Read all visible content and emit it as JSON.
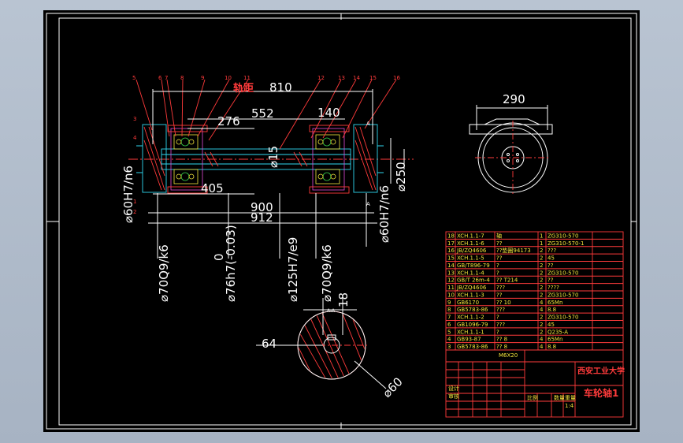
{
  "drawing": {
    "title_cn": "车轮轴1",
    "school": "西安工业大学",
    "dimensions": {
      "track_label": "轨距",
      "overall": "810",
      "d552": "552",
      "d276": "276",
      "d140": "140",
      "d405": "405",
      "d900": "900",
      "d912": "912",
      "d290": "290",
      "d250": "⌀250",
      "d15": "⌀15",
      "d64": "64",
      "d18": "18",
      "d60": "⌀60",
      "fit_left": "⌀60H7/n6",
      "fit_right": "⌀60H7/n6",
      "fit1": "⌀70Q9/k6",
      "fit2": "⌀76h7(-0.03)",
      "fit2_tol": "0",
      "fit3": "⌀125H7/e9",
      "fit4": "⌀70Q9/k6",
      "section_label": "A-A",
      "section_mark": "A"
    },
    "balloons": [
      "5",
      "6",
      "7",
      "8",
      "9",
      "10",
      "11",
      "12",
      "13",
      "14",
      "15",
      "16",
      "3",
      "4",
      "1",
      "2"
    ],
    "bom": [
      [
        "18",
        "XCH.1.1-7",
        "轴",
        "1",
        "ZG310-570",
        ""
      ],
      [
        "17",
        "XCH.1.1-6",
        "??",
        "1",
        "ZG310-570-1",
        ""
      ],
      [
        "16",
        "JB/ZQ4606",
        "??垫圈94173",
        "2",
        "???",
        ""
      ],
      [
        "15",
        "XCH.1.1-5",
        "??",
        "2",
        "45",
        ""
      ],
      [
        "14",
        "GB/T896-79",
        "?",
        "2",
        "??",
        ""
      ],
      [
        "13",
        "XCH.1.1-4",
        "?",
        "2",
        "ZG310-570",
        ""
      ],
      [
        "12",
        "GB/T 26m-4",
        "?? T214",
        "2",
        "??",
        ""
      ],
      [
        "11",
        "JB/ZQ4606",
        "???",
        "2",
        "????",
        ""
      ],
      [
        "10",
        "XCH.1.1-3",
        "??",
        "2",
        "ZG310-570",
        ""
      ],
      [
        "9",
        "GB6170",
        "?? 10",
        "4",
        "65Mn",
        ""
      ],
      [
        "8",
        "GB5783-86",
        "???",
        "4",
        "8.8",
        ""
      ],
      [
        "7",
        "XCH.1.1-2",
        "?",
        "2",
        "ZG310-570",
        ""
      ],
      [
        "6",
        "GB1096-79",
        "???",
        "2",
        "45",
        ""
      ],
      [
        "5",
        "XCH.1.1-1",
        "?",
        "2",
        "Q235-A",
        ""
      ],
      [
        "4",
        "GB93-87",
        "?? 8",
        "4",
        "65Mn",
        ""
      ],
      [
        "3",
        "GB5783-86",
        "?? 8",
        "4",
        "8.8",
        ""
      ]
    ],
    "bom_header_code": "M6X20",
    "title_block": {
      "scale_label": "比例",
      "scale": "1:4",
      "qty_label": "数量",
      "weight_label": "重量",
      "designer": "设计",
      "checker": "审核"
    }
  }
}
